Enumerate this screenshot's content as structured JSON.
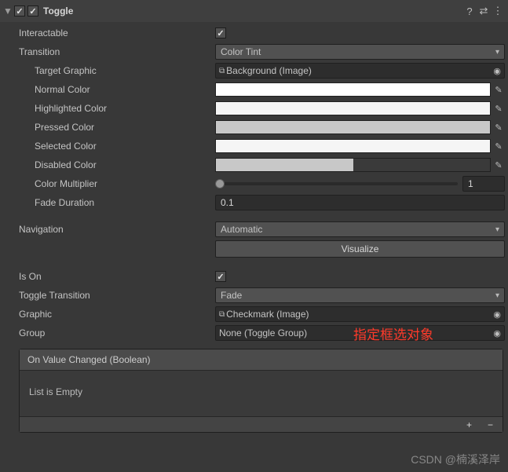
{
  "header": {
    "title": "Toggle",
    "enabled": true
  },
  "interactable": {
    "label": "Interactable",
    "value": true
  },
  "transition": {
    "label": "Transition",
    "value": "Color Tint",
    "target_graphic": {
      "label": "Target Graphic",
      "value": "Background (Image)"
    },
    "normal_color": {
      "label": "Normal Color",
      "hex": "#FFFFFF"
    },
    "highlighted_color": {
      "label": "Highlighted Color",
      "hex": "#F5F5F5"
    },
    "pressed_color": {
      "label": "Pressed Color",
      "hex": "#C8C8C8"
    },
    "selected_color": {
      "label": "Selected Color",
      "hex": "#F5F5F5"
    },
    "disabled_color": {
      "label": "Disabled Color",
      "hex": "#C8C8C8"
    },
    "color_multiplier": {
      "label": "Color Multiplier",
      "value": 1,
      "min": 1,
      "max": 5
    },
    "fade_duration": {
      "label": "Fade Duration",
      "value": "0.1"
    }
  },
  "navigation": {
    "label": "Navigation",
    "value": "Automatic",
    "visualize_label": "Visualize"
  },
  "is_on": {
    "label": "Is On",
    "value": true
  },
  "toggle_transition": {
    "label": "Toggle Transition",
    "value": "Fade"
  },
  "graphic": {
    "label": "Graphic",
    "value": "Checkmark (Image)"
  },
  "group": {
    "label": "Group",
    "value": "None (Toggle Group)"
  },
  "event": {
    "title": "On Value Changed (Boolean)",
    "empty_text": "List is Empty"
  },
  "annotation": "指定框选对象",
  "watermark": "CSDN @楠溪泽岸"
}
